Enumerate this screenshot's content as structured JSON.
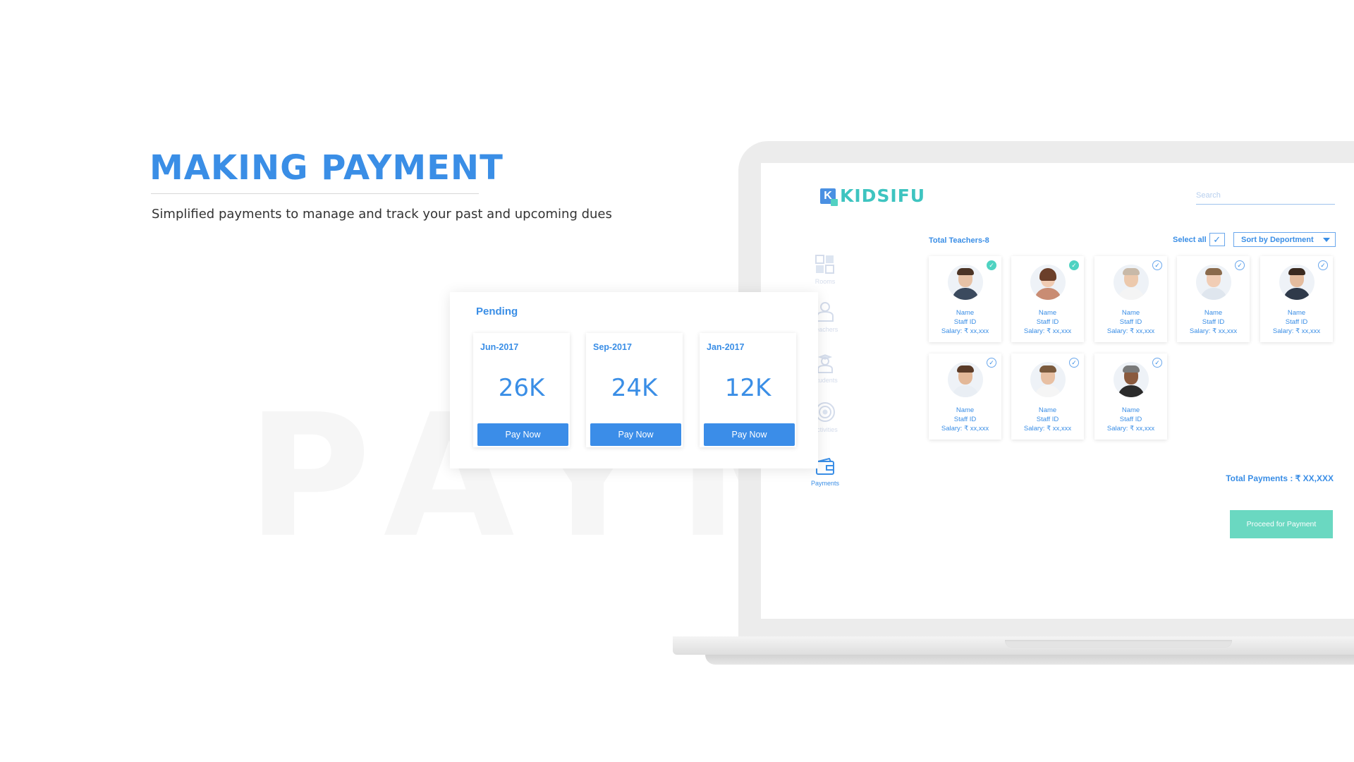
{
  "hero": {
    "title": "MAKING PAYMENT",
    "subtitle": "Simplified payments to manage and track your past and upcoming dues",
    "watermark": "PAYM"
  },
  "app": {
    "brand": "KIDSIFU",
    "logo_letter": "K",
    "search_placeholder": "Search",
    "nav": [
      {
        "label": "Rooms",
        "icon": "rooms-icon",
        "active": false
      },
      {
        "label": "Teachers",
        "icon": "teachers-icon",
        "active": false
      },
      {
        "label": "Students",
        "icon": "students-icon",
        "active": false
      },
      {
        "label": "Activities",
        "icon": "activities-icon",
        "active": false
      },
      {
        "label": "Payments",
        "icon": "wallet-icon",
        "active": true
      }
    ],
    "teachers_title": "Total Teachers-8",
    "select_all_label": "Select all",
    "select_all_mark": "✓",
    "sort_label": "Sort by Deportment",
    "teachers": [
      {
        "name": "Name",
        "staff_id": "Staff ID",
        "salary": "Salary: ₹ xx,xxx",
        "selected": true,
        "check": "✓"
      },
      {
        "name": "Name",
        "staff_id": "Staff ID",
        "salary": "Salary: ₹ xx,xxx",
        "selected": true,
        "check": "✓"
      },
      {
        "name": "Name",
        "staff_id": "Staff ID",
        "salary": "Salary: ₹ xx,xxx",
        "selected": false,
        "check": "✓"
      },
      {
        "name": "Name",
        "staff_id": "Staff ID",
        "salary": "Salary: ₹ xx,xxx",
        "selected": false,
        "check": "✓"
      },
      {
        "name": "Name",
        "staff_id": "Staff ID",
        "salary": "Salary: ₹ xx,xxx",
        "selected": false,
        "check": "✓"
      },
      {
        "name": "Name",
        "staff_id": "Staff ID",
        "salary": "Salary: ₹ xx,xxx",
        "selected": false,
        "check": "✓"
      },
      {
        "name": "Name",
        "staff_id": "Staff ID",
        "salary": "Salary: ₹ xx,xxx",
        "selected": false,
        "check": "✓"
      },
      {
        "name": "Name",
        "staff_id": "Staff ID",
        "salary": "Salary: ₹ xx,xxx",
        "selected": false,
        "check": "✓"
      }
    ],
    "total_payments": "Total Payments : ₹ XX,XXX",
    "proceed_label": "Proceed for Payment"
  },
  "pending": {
    "title": "Pending",
    "dues": [
      {
        "month": "Jun-2017",
        "amount": "26K",
        "button": "Pay Now"
      },
      {
        "month": "Sep-2017",
        "amount": "24K",
        "button": "Pay Now"
      },
      {
        "month": "Jan-2017",
        "amount": "12K",
        "button": "Pay Now"
      }
    ]
  },
  "colors": {
    "primary": "#3a8ee6",
    "teal": "#52d1c2",
    "proceed": "#6ad8c1"
  }
}
